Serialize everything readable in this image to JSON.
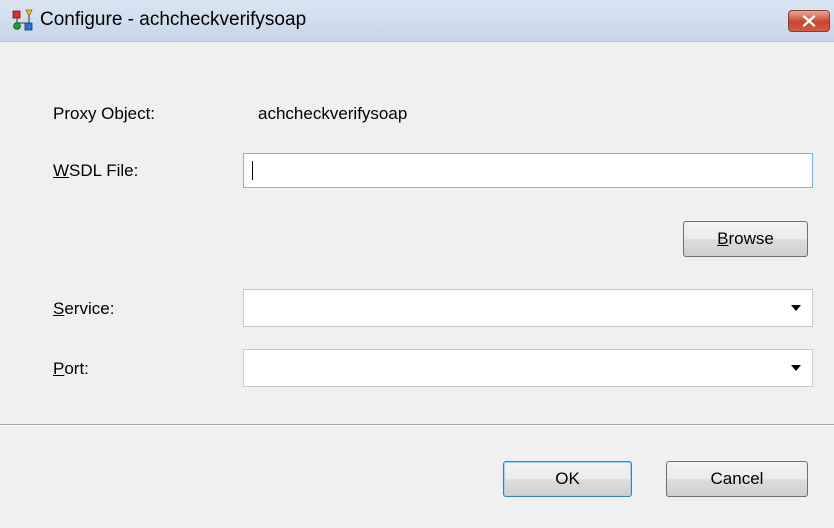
{
  "window": {
    "title": "Configure - achcheckverifysoap",
    "icon": "app-icon",
    "close_icon": "close-icon"
  },
  "form": {
    "proxy_object_label": "Proxy Object:",
    "proxy_object_value": "achcheckverifysoap",
    "wsdl_label_mnemonic": "W",
    "wsdl_label_rest": "SDL File:",
    "wsdl_value": "",
    "browse_mnemonic": "B",
    "browse_rest": "rowse",
    "service_label_mnemonic": "S",
    "service_label_rest": "ervice:",
    "service_value": "",
    "port_label_mnemonic": "P",
    "port_label_rest": "ort:",
    "port_value": ""
  },
  "buttons": {
    "ok": "OK",
    "cancel": "Cancel"
  }
}
